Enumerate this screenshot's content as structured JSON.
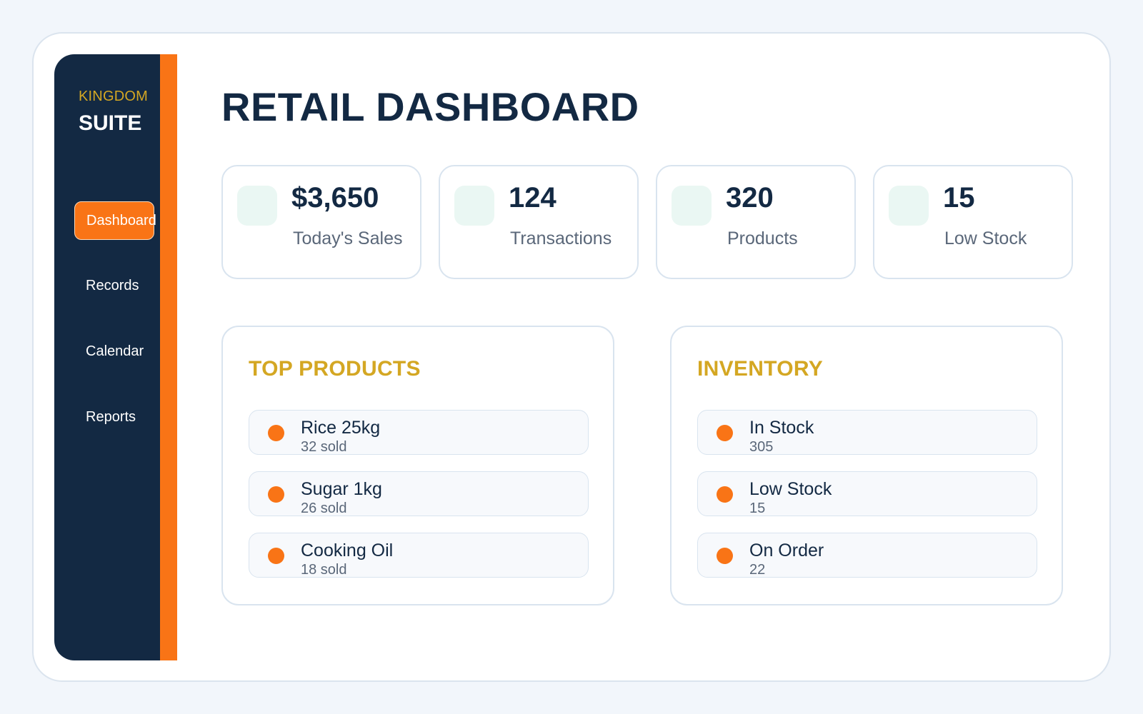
{
  "brand": {
    "top": "KINGDOM",
    "bottom": "SUITE"
  },
  "sidebar": {
    "items": [
      {
        "label": "Dashboard",
        "active": true
      },
      {
        "label": "Records",
        "active": false
      },
      {
        "label": "Calendar",
        "active": false
      },
      {
        "label": "Reports",
        "active": false
      }
    ]
  },
  "page": {
    "title": "RETAIL DASHBOARD"
  },
  "stats": [
    {
      "value": "$3,650",
      "label": "Today's Sales"
    },
    {
      "value": "124",
      "label": "Transactions"
    },
    {
      "value": "320",
      "label": "Products"
    },
    {
      "value": "15",
      "label": "Low Stock"
    }
  ],
  "top_products": {
    "title": "TOP PRODUCTS",
    "items": [
      {
        "name": "Rice 25kg",
        "sub": "32 sold"
      },
      {
        "name": "Sugar 1kg",
        "sub": "26 sold"
      },
      {
        "name": "Cooking Oil",
        "sub": "18 sold"
      }
    ]
  },
  "inventory": {
    "title": "INVENTORY",
    "items": [
      {
        "name": "In Stock",
        "sub": "305"
      },
      {
        "name": "Low Stock",
        "sub": "15"
      },
      {
        "name": "On Order",
        "sub": "22"
      }
    ]
  },
  "colors": {
    "navy": "#132943",
    "accent_orange": "#f97416",
    "gold": "#d4a723",
    "page_bg": "#f2f6fb",
    "icon_tile": "#eaf7f3"
  }
}
